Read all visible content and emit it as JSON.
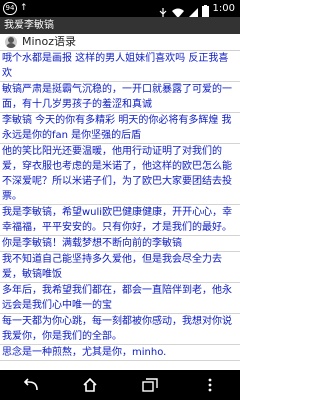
{
  "status_bar": {
    "notification_count": "94",
    "time": "1:00"
  },
  "title_bar": {
    "title": "我爱李敏镐"
  },
  "header": {
    "title": "Minoz语录"
  },
  "posts": [
    "哦个水都是画报 这样的男人姐妹们喜欢吗 反正我喜欢",
    "敏镐严肃是挺霸气沉稳的，一开口就暴露了可爱的一面，有十几岁男孩子的羞涩和真诚",
    "李敏镐 今天的你有多精彩 明天的你必将有多辉煌 我永远是你的fan 是你坚强的后盾",
    "他的笑比阳光还要温暖，他用行动证明了对我们的爱，穿衣服也考虑的是米诺了，他这样的欧巴怎么能不深爱呢？所以米诺子们，为了欧巴大家要团结去投票。",
    "我是李敏镐，希望wuli欧巴健康健康，开开心心，幸幸福福，平平安安的。只有你好，才是我们的最好。",
    "你是李敏镐！满载梦想不断向前的李敏镐",
    "我不知道自己能坚持多久爱他，但是我会尽全力去爱，敏镐唯饭",
    "多年后，我希望我们都在，都会一直陪伴到老，他永远会是我们心中唯一的宝",
    "每一天都为你心跳，每一刻都被你感动，我想对你说我爱你，你是我们的全部。",
    "思念是一种煎熬，尤其是你，minho."
  ]
}
